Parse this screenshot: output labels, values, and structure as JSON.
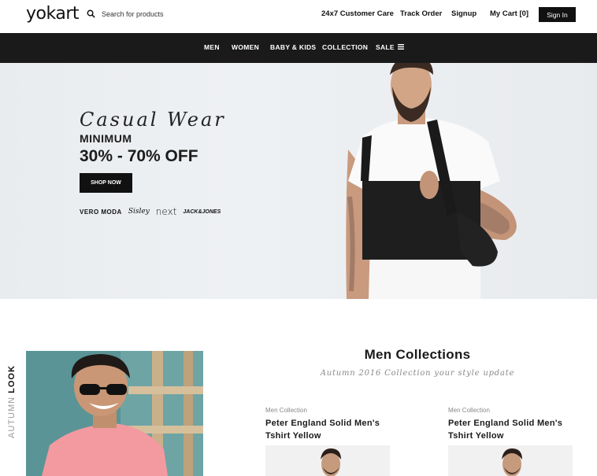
{
  "header": {
    "logo": "yokart",
    "search_placeholder": "Search for products",
    "links": [
      "24x7 Customer Care",
      "Track Order",
      "Signup",
      "My Cart [0]"
    ],
    "signin_label": "Sign In"
  },
  "nav": {
    "items": [
      "MEN",
      "WOMEN",
      "BABY & KIDS",
      "COLLECTION",
      "SALE"
    ],
    "menu_icon": "hamburger-icon"
  },
  "hero": {
    "script_title": "Casual Wear",
    "minimum": "MINIMUM",
    "discount": "30% - 70% OFF",
    "cta": "SHOP NOW",
    "brands": [
      "VERO MODA",
      "Sisley",
      "next",
      "JACK&JONES"
    ]
  },
  "autumn": {
    "label_light": "AUTUMN",
    "label_bold": "LOOK"
  },
  "collections": {
    "title": "Men Collections",
    "subtitle": "Autumn 2016 Collection your style update",
    "products": [
      {
        "category": "Men Collection",
        "name_line1": "Peter England Solid Men's",
        "name_line2": "Tshirt Yellow"
      },
      {
        "category": "Men Collection",
        "name_line1": "Peter England Solid Men's",
        "name_line2": "Tshirt Yellow"
      }
    ]
  },
  "colors": {
    "nav_bg": "#1a1a1a",
    "button_bg": "#111111",
    "hero_bg": "#e9ecef"
  }
}
